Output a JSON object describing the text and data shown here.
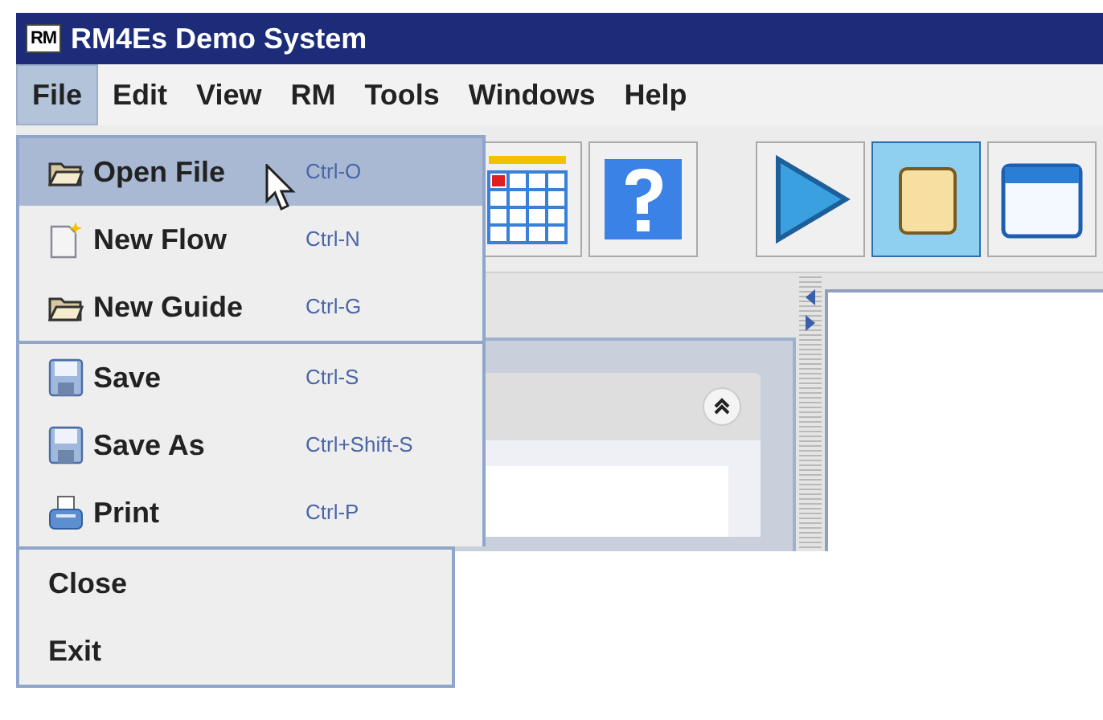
{
  "window": {
    "logo": "RM",
    "title": "RM4Es Demo System"
  },
  "menubar": [
    {
      "label": "File",
      "selected": true
    },
    {
      "label": "Edit",
      "selected": false
    },
    {
      "label": "View",
      "selected": false
    },
    {
      "label": "RM",
      "selected": false
    },
    {
      "label": "Tools",
      "selected": false
    },
    {
      "label": "Windows",
      "selected": false
    },
    {
      "label": "Help",
      "selected": false
    }
  ],
  "toolbar": [
    {
      "selected": false
    },
    {
      "selected": false
    },
    {
      "selected": false
    },
    {
      "selected": true
    },
    {
      "selected": false
    }
  ],
  "file_menu": [
    [
      {
        "label": "Open File",
        "shortcut": "Ctrl-O",
        "selected": true
      },
      {
        "label": "New Flow",
        "shortcut": "Ctrl-N",
        "selected": false
      },
      {
        "label": "New Guide",
        "shortcut": "Ctrl-G",
        "selected": false
      }
    ],
    [
      {
        "label": "Save",
        "shortcut": "Ctrl-S",
        "selected": false
      },
      {
        "label": "Save As",
        "shortcut": "Ctrl+Shift-S",
        "selected": false
      },
      {
        "label": "Print",
        "shortcut": "Ctrl-P",
        "selected": false
      }
    ],
    [
      {
        "label": "Close",
        "selected": false
      },
      {
        "label": "Exit",
        "selected": false
      }
    ]
  ]
}
